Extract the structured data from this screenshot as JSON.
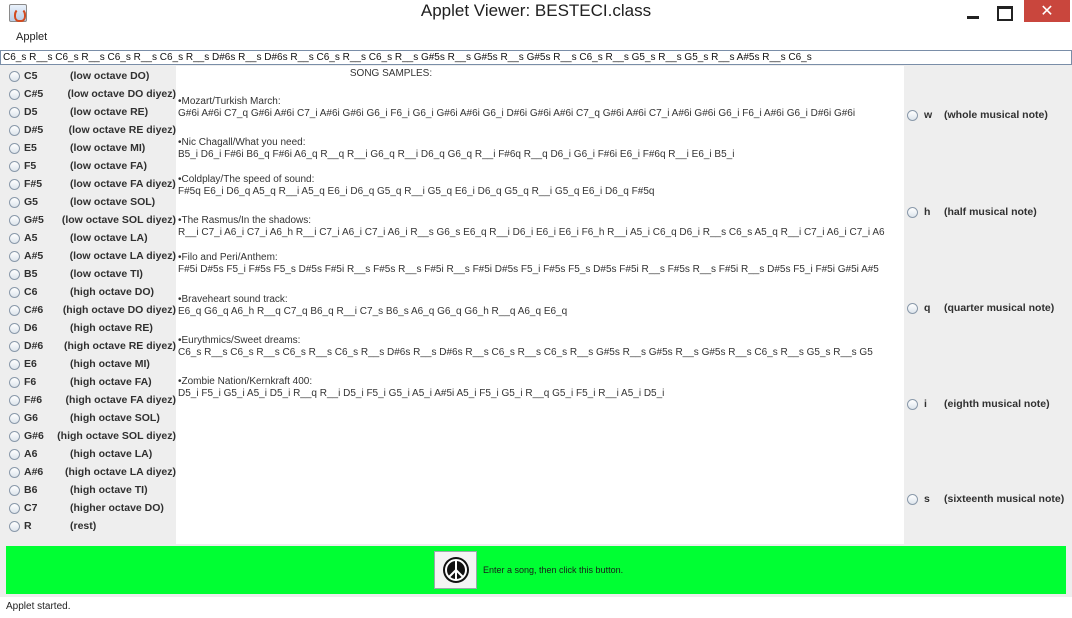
{
  "window": {
    "title": "Applet Viewer: BESTECI.class",
    "icon": "java-cup-icon"
  },
  "menu": {
    "applet_label": "Applet"
  },
  "song_input": {
    "value": "C6_s R__s C6_s R__s C6_s R__s C6_s R__s D#6s R__s D#6s R__s C6_s R__s C6_s R__s G#5s R__s G#5s R__s G#5s R__s C6_s R__s G5_s R__s G5_s R__s A#5s R__s C6_s"
  },
  "notes": [
    {
      "name": "C5",
      "desc": "(low octave DO)"
    },
    {
      "name": "C#5",
      "desc": "(low octave DO diyez)"
    },
    {
      "name": "D5",
      "desc": "(low octave RE)"
    },
    {
      "name": "D#5",
      "desc": "(low octave RE diyez)"
    },
    {
      "name": "E5",
      "desc": "(low octave MI)"
    },
    {
      "name": "F5",
      "desc": "(low octave FA)"
    },
    {
      "name": "F#5",
      "desc": "(low octave FA diyez)"
    },
    {
      "name": "G5",
      "desc": "(low octave SOL)"
    },
    {
      "name": "G#5",
      "desc": "(low octave SOL diyez)"
    },
    {
      "name": "A5",
      "desc": "(low octave LA)"
    },
    {
      "name": "A#5",
      "desc": "(low octave LA diyez)"
    },
    {
      "name": "B5",
      "desc": "(low octave TI)"
    },
    {
      "name": "C6",
      "desc": "(high octave DO)"
    },
    {
      "name": "C#6",
      "desc": "(high octave DO diyez)"
    },
    {
      "name": "D6",
      "desc": "(high octave RE)"
    },
    {
      "name": "D#6",
      "desc": "(high octave RE diyez)"
    },
    {
      "name": "E6",
      "desc": "(high octave MI)"
    },
    {
      "name": "F6",
      "desc": "(high octave FA)"
    },
    {
      "name": "F#6",
      "desc": "(high octave FA diyez)"
    },
    {
      "name": "G6",
      "desc": "(high octave SOL)"
    },
    {
      "name": "G#6",
      "desc": "(high octave SOL diyez)"
    },
    {
      "name": "A6",
      "desc": "(high octave LA)"
    },
    {
      "name": "A#6",
      "desc": "(high octave LA diyez)"
    },
    {
      "name": "B6",
      "desc": "(high octave TI)"
    },
    {
      "name": "C7",
      "desc": "(higher octave DO)"
    },
    {
      "name": "R",
      "desc": "(rest)"
    }
  ],
  "samples": {
    "title": "SONG SAMPLES:",
    "songs": [
      {
        "name": "Mozart/Turkish March:",
        "notes": "G#6i A#6i C7_q G#6i A#6i C7_i A#6i G#6i G6_i F6_i G6_i G#6i A#6i G6_i D#6i G#6i A#6i C7_q G#6i A#6i C7_i A#6i G#6i G6_i F6_i A#6i G6_i D#6i G#6i"
      },
      {
        "name": "Nic Chagall/What you need:",
        "notes": "B5_i D6_i F#6i B6_q F#6i A6_q R__q R__i G6_q R__i D6_q G6_q R__i F#6q R__q D6_i G6_i F#6i E6_i F#6q R__i E6_i B5_i"
      },
      {
        "name": "Coldplay/The speed of sound:",
        "notes": "F#5q E6_i D6_q A5_q R__i A5_q E6_i D6_q G5_q R__i G5_q E6_i D6_q G5_q R__i G5_q E6_i D6_q F#5q"
      },
      {
        "name": "The Rasmus/In the shadows:",
        "notes": "R__i C7_i A6_i C7_i A6_h R__i C7_i A6_i C7_i A6_i R__s G6_s E6_q R__i D6_i E6_i E6_i F6_h R__i A5_i C6_q D6_i R__s C6_s A5_q R__i C7_i A6_i C7_i A6"
      },
      {
        "name": "Filo and Peri/Anthem:",
        "notes": "F#5i D#5s F5_i F#5s F5_s D#5s F#5i R__s F#5s R__s F#5i R__s F#5i D#5s F5_i F#5s F5_s D#5s F#5i R__s F#5s R__s F#5i R__s D#5s F5_i F#5i G#5i A#5"
      },
      {
        "name": "Braveheart sound track:",
        "notes": "E6_q G6_q A6_h R__q C7_q B6_q R__i C7_s B6_s A6_q G6_q G6_h R__q A6_q E6_q"
      },
      {
        "name": "Eurythmics/Sweet dreams:",
        "notes": "C6_s R__s C6_s R__s C6_s R__s C6_s R__s D#6s R__s D#6s R__s C6_s R__s C6_s R__s G#5s R__s G#5s R__s G#5s R__s C6_s R__s G5_s R__s G5"
      },
      {
        "name": "Zombie Nation/Kernkraft 400:",
        "notes": "D5_i F5_i G5_i A5_i D5_i R__q R__i D5_i F5_i G5_i A5_i A#5i A5_i F5_i G5_i R__q G5_i F5_i R__i A5_i D5_i"
      }
    ]
  },
  "durations": [
    {
      "key": "w",
      "desc": "(whole musical note)"
    },
    {
      "key": "h",
      "desc": "(half musical note)"
    },
    {
      "key": "q",
      "desc": "(quarter musical note)"
    },
    {
      "key": "i",
      "desc": "(eighth musical note)"
    },
    {
      "key": "s",
      "desc": "(sixteenth musical note)"
    }
  ],
  "play": {
    "icon": "peace-symbol-icon",
    "hint": "Enter a song, then click this button."
  },
  "status": {
    "text": "Applet started."
  },
  "colors": {
    "bottom_bar": "#00ff33",
    "close_button": "#c9463d"
  }
}
